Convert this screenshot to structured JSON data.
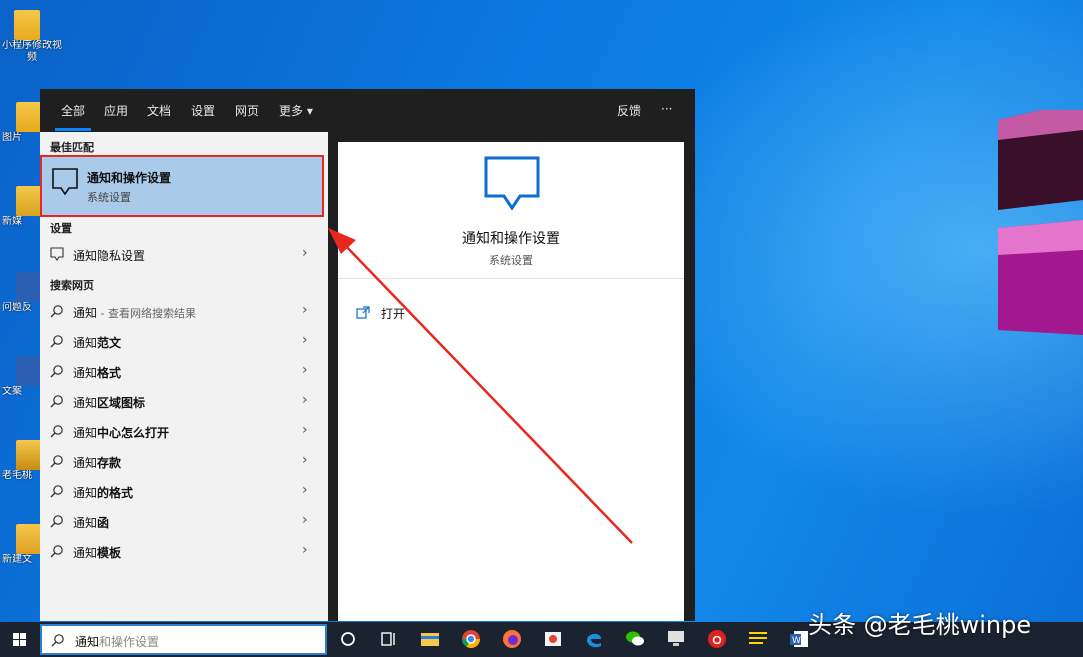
{
  "desktop": {
    "icons": [
      {
        "label": "小程序修改视频"
      },
      {
        "label": "图片"
      },
      {
        "label": "新媒"
      },
      {
        "label": "问题反"
      },
      {
        "label": "文案"
      },
      {
        "label": "老毛桃"
      },
      {
        "label": "新建文"
      }
    ]
  },
  "search_panel": {
    "tabs": [
      {
        "label": "全部",
        "active": true
      },
      {
        "label": "应用"
      },
      {
        "label": "文档"
      },
      {
        "label": "设置"
      },
      {
        "label": "网页"
      },
      {
        "label": "更多 ▾"
      }
    ],
    "feedback_label": "反馈",
    "more_options_label": "···",
    "best_match": {
      "section_label": "最佳匹配",
      "title": "通知和操作设置",
      "subtitle": "系统设置"
    },
    "settings": {
      "section_label": "设置",
      "items": [
        {
          "label": "通知隐私设置"
        }
      ]
    },
    "web": {
      "section_label": "搜索网页",
      "first": {
        "prefix": "通知",
        "hint": " - 查看网络搜索结果"
      },
      "items": [
        {
          "prefix": "通知",
          "suffix": "范文"
        },
        {
          "prefix": "通知",
          "suffix": "格式"
        },
        {
          "prefix": "通知",
          "suffix": "区域图标"
        },
        {
          "prefix": "通知",
          "suffix": "中心怎么打开"
        },
        {
          "prefix": "通知",
          "suffix": "存款"
        },
        {
          "prefix": "通知",
          "suffix": "的格式"
        },
        {
          "prefix": "通知",
          "suffix": "函"
        },
        {
          "prefix": "通知",
          "suffix": "模板"
        }
      ]
    },
    "preview": {
      "title": "通知和操作设置",
      "subtitle": "系统设置",
      "open_label": "打开"
    }
  },
  "taskbar": {
    "search_typed": "通知",
    "search_completion": "和操作设置"
  },
  "watermark": "头条 @老毛桃winpe",
  "colors": {
    "accent": "#0a84ff",
    "highlight": "#a9cbe9",
    "annotation": "#e8281e"
  }
}
